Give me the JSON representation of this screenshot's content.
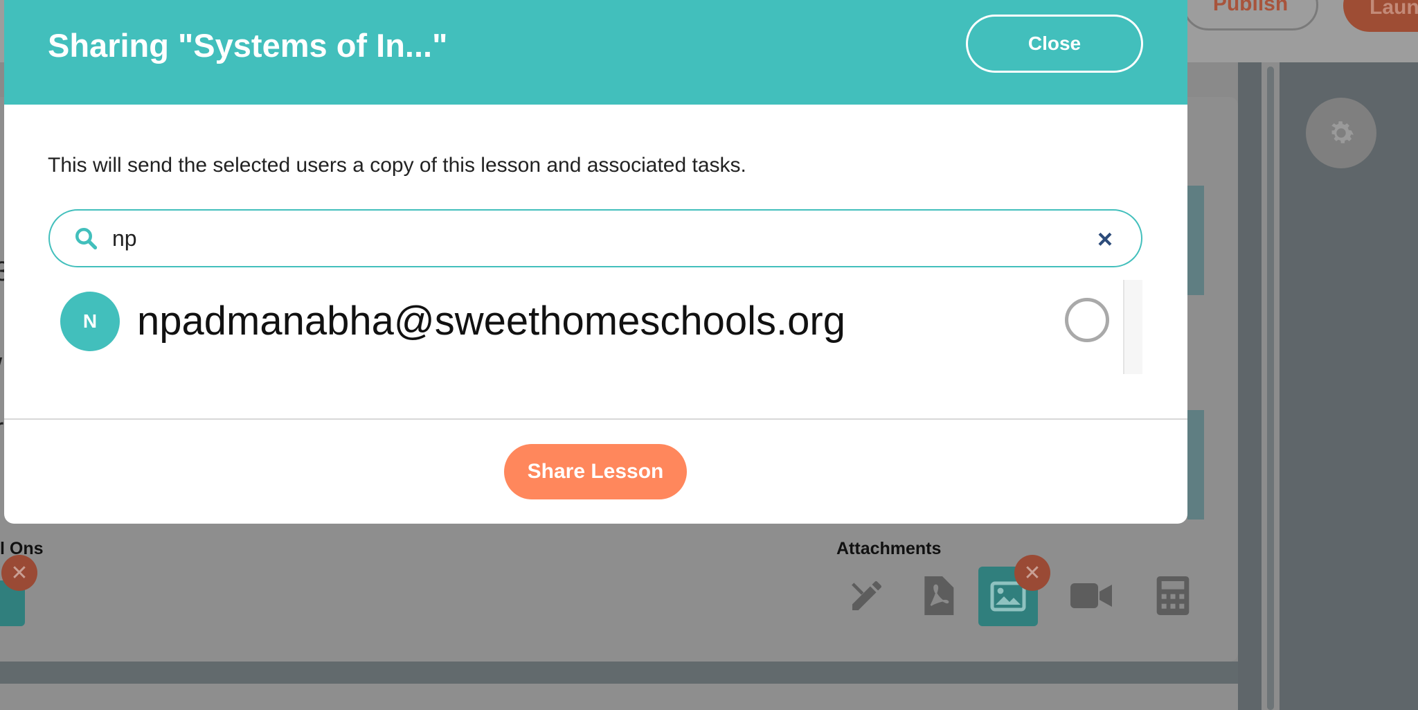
{
  "background": {
    "publish_label": "Publish",
    "launch_label": "Laun",
    "add_ons_label": "l Ons",
    "attachments_label": "Attachments"
  },
  "modal": {
    "title": "Sharing \"Systems of In...\"",
    "close_label": "Close",
    "description": "This will send the selected users a copy of this lesson and associated tasks.",
    "search": {
      "value": "np",
      "placeholder": ""
    },
    "results": [
      {
        "initial": "N",
        "email": "npadmanabha@sweethomeschools.org",
        "selected": false
      }
    ],
    "share_label": "Share Lesson"
  },
  "colors": {
    "teal": "#42bfbc",
    "orange": "#ff875c",
    "clear_icon": "#2d4c7a"
  },
  "icons": [
    "search-icon",
    "clear-icon",
    "gear-icon",
    "edit-tools-icon",
    "pdf-icon",
    "image-icon",
    "video-icon",
    "calculator-icon",
    "remove-icon"
  ]
}
